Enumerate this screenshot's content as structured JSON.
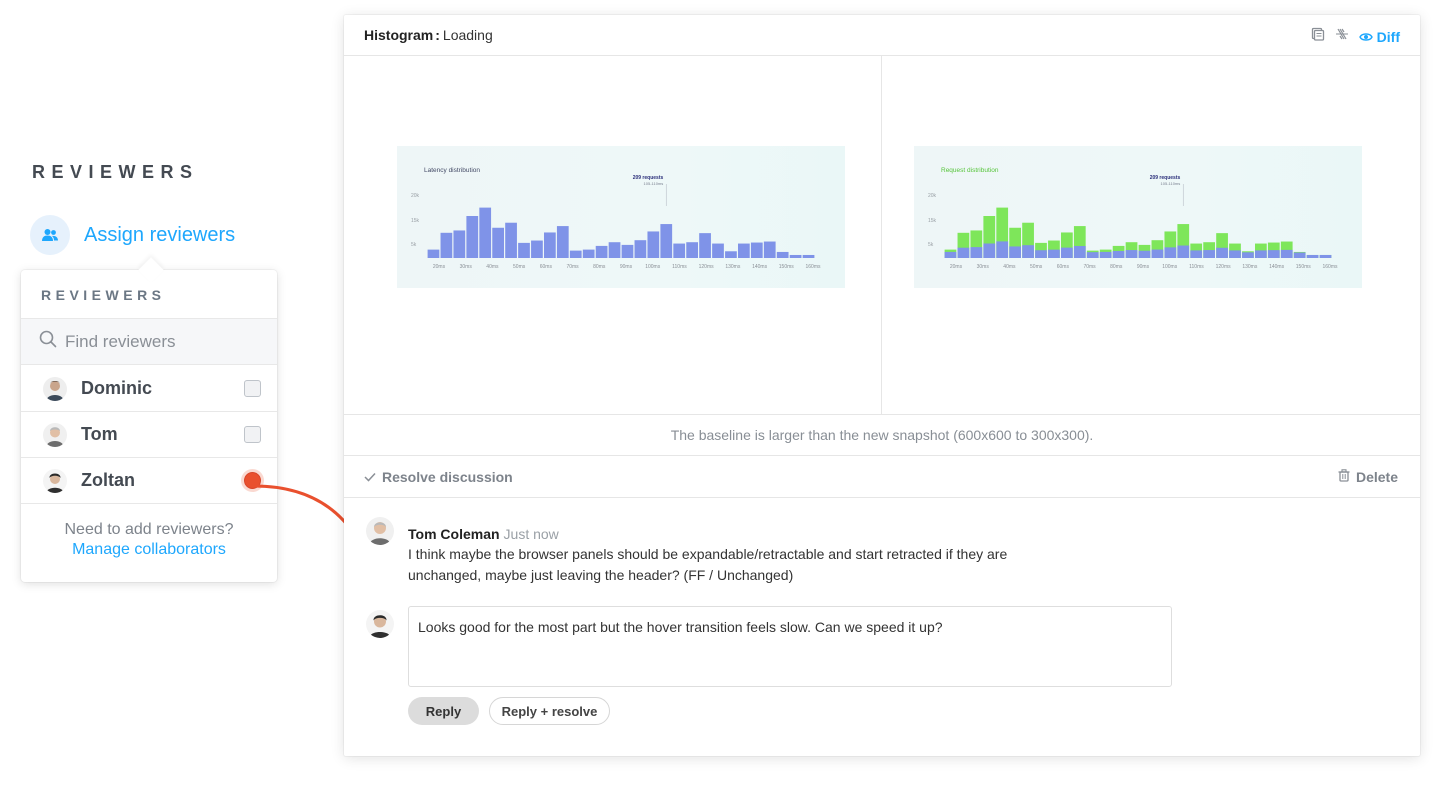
{
  "reviewers_panel": {
    "heading": "REVIEWERS",
    "assign_label": "Assign reviewers",
    "popover": {
      "title": "REVIEWERS",
      "search_placeholder": "Find reviewers",
      "reviewers": [
        {
          "name": "Dominic",
          "checked": false
        },
        {
          "name": "Tom",
          "checked": false
        },
        {
          "name": "Zoltan",
          "checked": true
        }
      ],
      "footer_question": "Need to add reviewers?",
      "footer_link": "Manage collaborators"
    }
  },
  "card": {
    "title_strong": "Histogram",
    "title_sep": ":",
    "title_value": "Loading",
    "diff_label": "Diff",
    "notice": "The baseline is larger than the new snapshot (600x600 to 300x300).",
    "resolve_label": "Resolve discussion",
    "delete_label": "Delete",
    "comment": {
      "author": "Tom Coleman",
      "time": "Just now",
      "text": "I think maybe the browser panels should be expandable/retractable and start retracted if they are unchanged, maybe just leaving the header? (FF / Unchanged)"
    },
    "reply": {
      "value": "Looks good for the most part but the hover transition feels slow. Can we speed it up?",
      "reply_button": "Reply",
      "reply_resolve_button": "Reply + resolve"
    }
  },
  "colors": {
    "accent": "#1ea7fd",
    "annotation": "#e9502e",
    "bar_blue": "#7f93e8",
    "bar_green": "#7ee65a"
  },
  "chart_data": [
    {
      "type": "bar",
      "title": "Latency distribution",
      "annotation": "209 requests",
      "annotation_sub": "105-110ms",
      "x_tick_labels": [
        "20ms",
        "30ms",
        "40ms",
        "50ms",
        "60ms",
        "70ms",
        "80ms",
        "90ms",
        "100ms",
        "110ms",
        "120ms",
        "130ms",
        "140ms",
        "150ms",
        "160ms"
      ],
      "y_tick_labels": [
        "20k",
        "15k",
        "5k"
      ],
      "ylim": [
        0,
        25000
      ],
      "series": [
        {
          "values": [
            2500,
            7500,
            8200,
            12500,
            15000,
            9000,
            10500,
            4500,
            5200,
            7600,
            9500,
            2200,
            2500,
            3600,
            4700,
            3900,
            5300,
            7900,
            10100,
            4300,
            4700,
            7400,
            4300,
            2000,
            4300,
            4600,
            4900,
            1800,
            900,
            900
          ]
        }
      ]
    },
    {
      "type": "bar",
      "title": "Request distribution",
      "annotation": "209 requests",
      "annotation_sub": "105-110ms",
      "x_tick_labels": [
        "20ms",
        "30ms",
        "40ms",
        "50ms",
        "60ms",
        "70ms",
        "80ms",
        "90ms",
        "100ms",
        "110ms",
        "120ms",
        "130ms",
        "140ms",
        "150ms",
        "160ms"
      ],
      "y_tick_labels": [
        "20k",
        "15k",
        "5k"
      ],
      "ylim": [
        0,
        25000
      ],
      "series": [
        {
          "values": [
            2500,
            7500,
            8200,
            12500,
            15000,
            9000,
            10500,
            4500,
            5200,
            7600,
            9500,
            2200,
            2500,
            3600,
            4700,
            3900,
            5300,
            7900,
            10100,
            4300,
            4700,
            7400,
            4300,
            2000,
            4300,
            4600,
            4900,
            1800,
            900,
            900
          ]
        },
        {
          "values": [
            2500,
            7500,
            8200,
            12500,
            15000,
            9000,
            10500,
            4500,
            5200,
            7600,
            9500,
            2200,
            2500,
            3600,
            4700,
            3900,
            5300,
            7900,
            10100,
            4300,
            4700,
            7400,
            4300,
            2000,
            4300,
            4600,
            4900,
            1800,
            900,
            900
          ]
        }
      ]
    }
  ]
}
